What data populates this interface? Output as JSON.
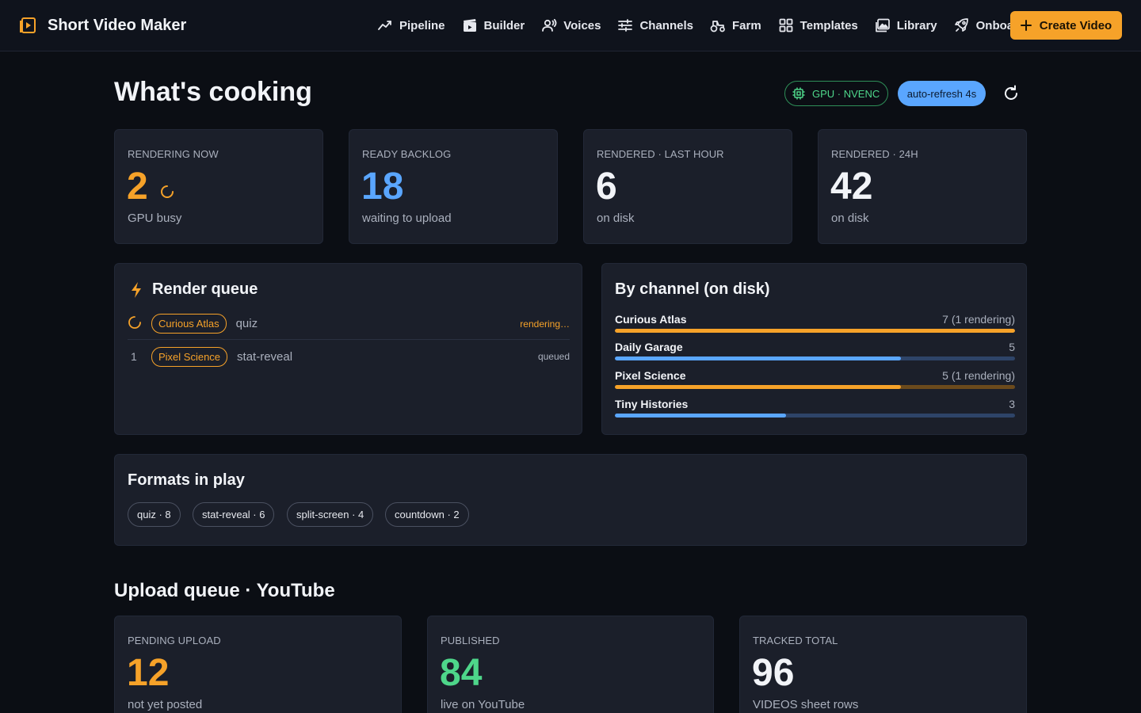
{
  "app": {
    "title": "Short Video Maker"
  },
  "nav": {
    "items": [
      {
        "label": "Pipeline",
        "icon": "pipeline-icon"
      },
      {
        "label": "Builder",
        "icon": "clapperboard-icon"
      },
      {
        "label": "Voices",
        "icon": "voices-icon"
      },
      {
        "label": "Channels",
        "icon": "sliders-icon"
      },
      {
        "label": "Farm",
        "icon": "tractor-icon"
      },
      {
        "label": "Templates",
        "icon": "grid-icon"
      },
      {
        "label": "Library",
        "icon": "images-icon"
      },
      {
        "label": "Onboard",
        "icon": "rocket-icon"
      }
    ],
    "create_label": "Create Video"
  },
  "header": {
    "title": "What's cooking",
    "gpu_label": "GPU · NVENC",
    "refresh_label": "auto-refresh 4s"
  },
  "stats": [
    {
      "label": "RENDERING NOW",
      "value": "2",
      "sub": "GPU busy",
      "color": "#f6a229"
    },
    {
      "label": "READY BACKLOG",
      "value": "18",
      "sub": "waiting to upload",
      "color": "#5aa6ff"
    },
    {
      "label": "RENDERED · LAST HOUR",
      "value": "6",
      "sub": "on disk",
      "color": "#f2f4f8"
    },
    {
      "label": "RENDERED · 24H",
      "value": "42",
      "sub": "on disk",
      "color": "#f2f4f8"
    }
  ],
  "render_queue": {
    "title": "Render queue",
    "items": [
      {
        "num": "",
        "channel": "Curious Atlas",
        "format": "quiz",
        "status": "rendering…"
      },
      {
        "num": "1",
        "channel": "Pixel Science",
        "format": "stat-reveal",
        "status": "queued"
      }
    ]
  },
  "by_channel": {
    "title": "By channel (on disk)",
    "max": 7,
    "items": [
      {
        "name": "Curious Atlas",
        "count": "7 (1 rendering)",
        "value": 7,
        "rendering": true
      },
      {
        "name": "Daily Garage",
        "count": "5",
        "value": 5,
        "rendering": false
      },
      {
        "name": "Pixel Science",
        "count": "5 (1 rendering)",
        "value": 5,
        "rendering": true
      },
      {
        "name": "Tiny Histories",
        "count": "3",
        "value": 3,
        "rendering": false
      }
    ]
  },
  "formats": {
    "title": "Formats in play",
    "chips": [
      "quiz · 8",
      "stat-reveal · 6",
      "split-screen · 4",
      "countdown · 2"
    ]
  },
  "upload": {
    "title": "Upload queue · YouTube",
    "stats": [
      {
        "label": "PENDING UPLOAD",
        "value": "12",
        "sub": "not yet posted",
        "color": "#f6a229"
      },
      {
        "label": "PUBLISHED",
        "value": "84",
        "sub": "live on YouTube",
        "color": "#4ed68a"
      },
      {
        "label": "TRACKED TOTAL",
        "value": "96",
        "sub": "VIDEOS sheet rows",
        "color": "#f2f4f8"
      }
    ]
  },
  "colors": {
    "accent": "#f6a229",
    "blue": "#5aa6ff",
    "green": "#4ed68a",
    "track": "#2e4468"
  }
}
